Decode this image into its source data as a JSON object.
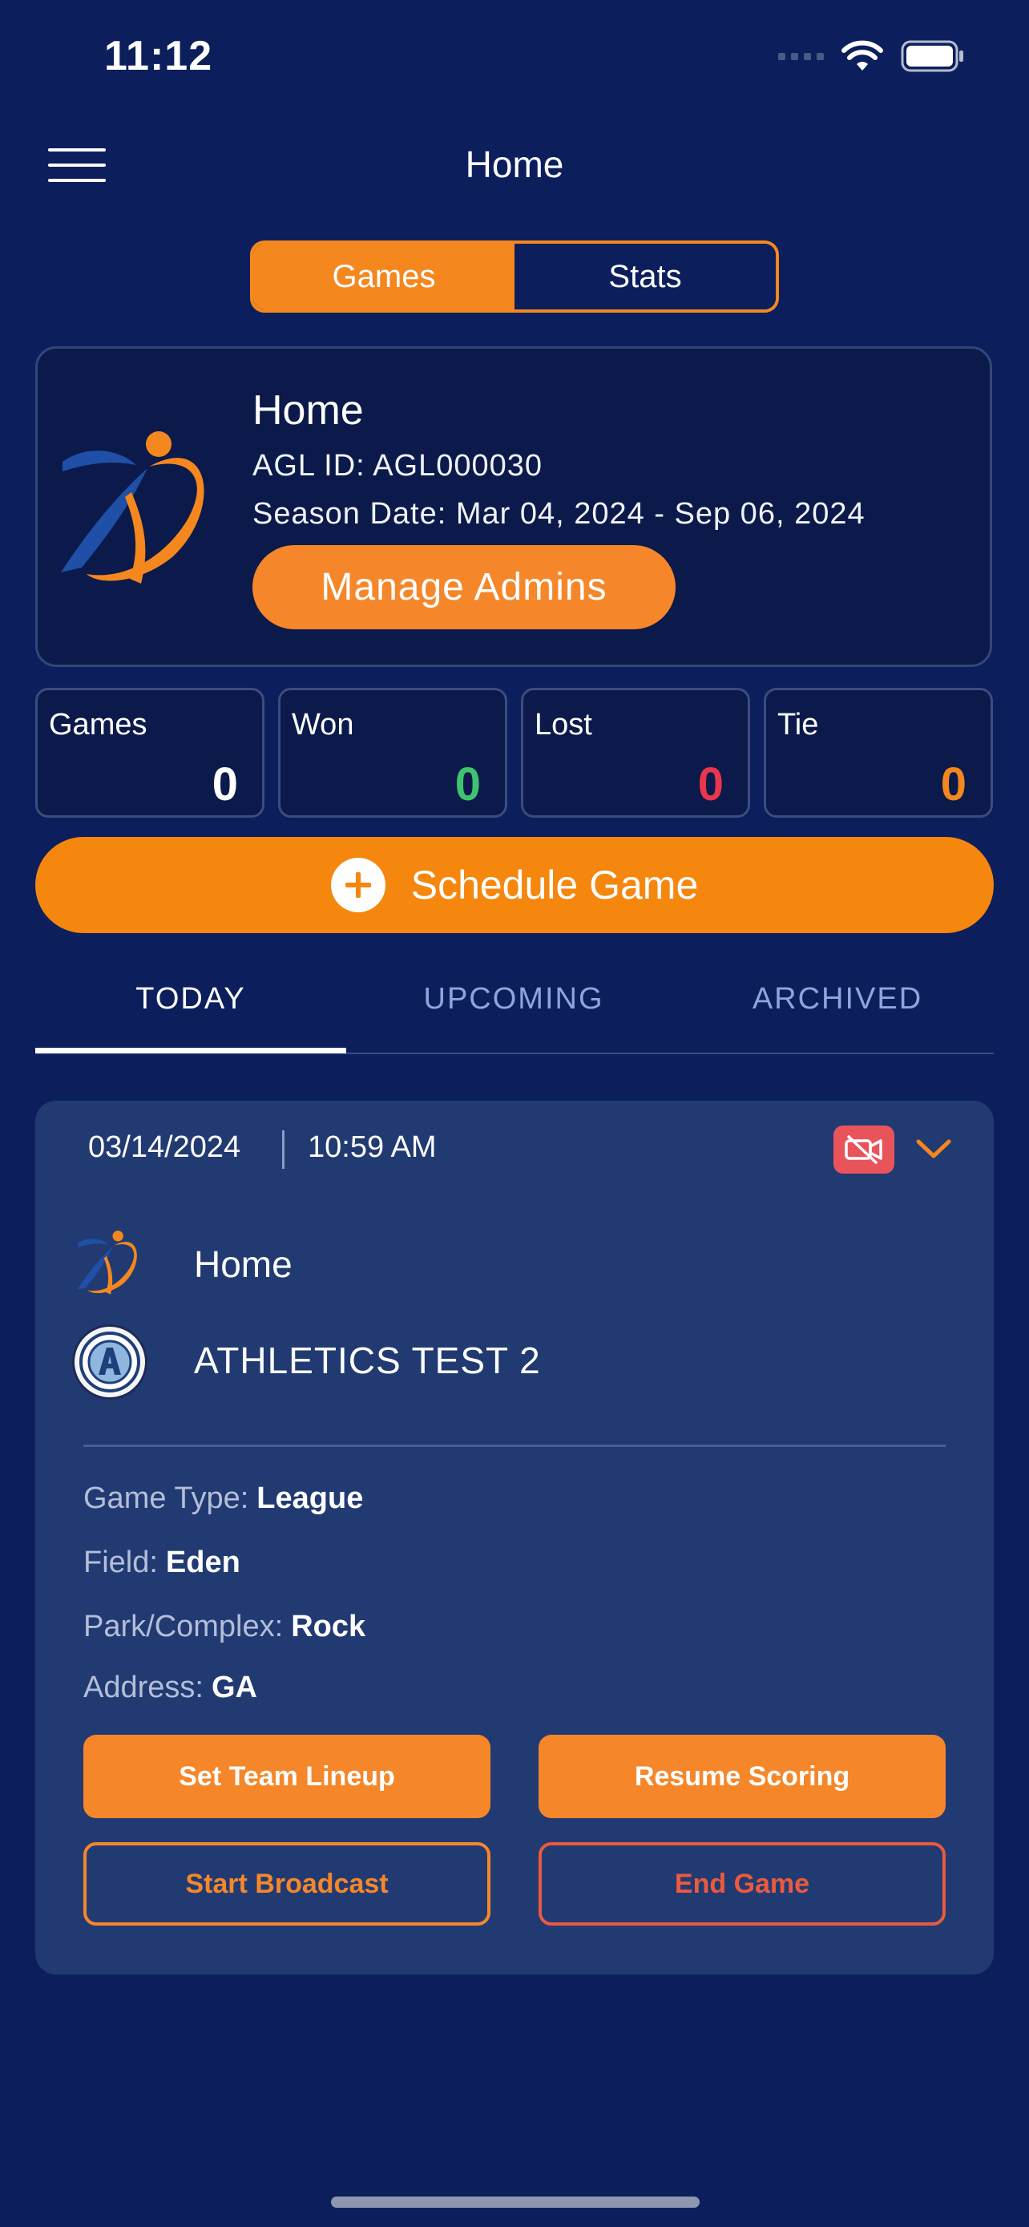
{
  "status_bar": {
    "time": "11:12",
    "icons": [
      "signal-icon",
      "wifi-icon",
      "battery-icon"
    ]
  },
  "nav": {
    "title": "Home",
    "menu_icon": "hamburger-icon"
  },
  "segment": {
    "options": [
      "Games",
      "Stats"
    ],
    "selected": "Games"
  },
  "team": {
    "name": "Home",
    "agl_id": "AGL ID: AGL000030",
    "season": "Season Date: Mar 04, 2024 - Sep 06, 2024",
    "manage_label": "Manage Admins"
  },
  "stats": [
    {
      "label": "Games",
      "value": "0",
      "color": "#ffffff"
    },
    {
      "label": "Won",
      "value": "0",
      "color": "#3ec46d"
    },
    {
      "label": "Lost",
      "value": "0",
      "color": "#e8364a"
    },
    {
      "label": "Tie",
      "value": "0",
      "color": "#f5871f"
    }
  ],
  "schedule_label": "Schedule Game",
  "tabs": [
    "TODAY",
    "UPCOMING",
    "ARCHIVED"
  ],
  "active_tab": "TODAY",
  "game": {
    "date": "03/14/2024",
    "time": "10:59 AM",
    "team1": "Home",
    "team2": "ATHLETICS TEST 2",
    "type_label": "Game Type:",
    "type_value": "League",
    "field_label": "Field:",
    "field_value": "Eden",
    "park_label": "Park/Complex:",
    "park_value": "Rock",
    "address_label": "Address:",
    "address_value": "GA",
    "buttons": {
      "lineup": "Set Team Lineup",
      "resume": "Resume Scoring",
      "broadcast": "Start Broadcast",
      "end": "End Game"
    }
  },
  "colors": {
    "background": "#0c1f5c",
    "accent": "#f5871f",
    "card": "#223a72"
  }
}
